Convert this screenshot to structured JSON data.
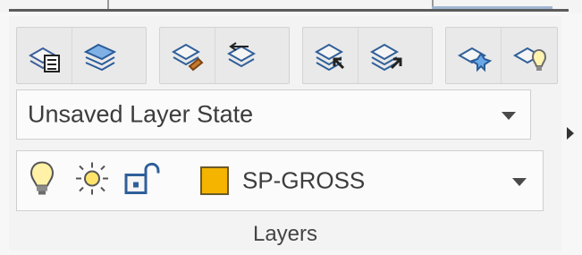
{
  "panel": {
    "title": "Layers"
  },
  "toolbar": {
    "groups": [
      {
        "buttons": [
          {
            "icon": "layer-properties-icon"
          },
          {
            "icon": "layer-states-icon"
          }
        ]
      },
      {
        "buttons": [
          {
            "icon": "match-layer-icon"
          },
          {
            "icon": "previous-layer-icon"
          }
        ]
      },
      {
        "buttons": [
          {
            "icon": "layer-isolate-icon"
          },
          {
            "icon": "layer-unisolate-icon"
          }
        ]
      },
      {
        "buttons": [
          {
            "icon": "layer-freeze-icon"
          },
          {
            "icon": "layer-off-icon"
          }
        ]
      }
    ]
  },
  "layer_state": {
    "value": "Unsaved Layer State"
  },
  "current_layer": {
    "name": "SP-GROSS",
    "color": "#f4b400",
    "icons": [
      "lightbulb-on-icon",
      "sun-thaw-icon",
      "unlock-icon",
      "color-swatch"
    ]
  }
}
